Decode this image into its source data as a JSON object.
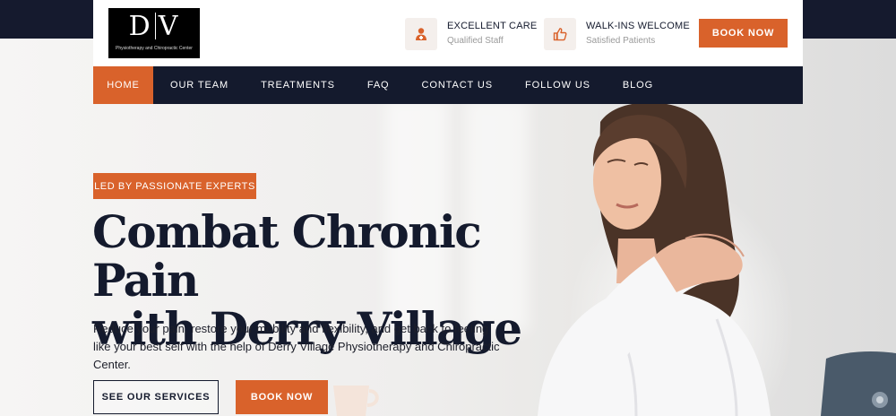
{
  "brand": {
    "logo_mark_left": "D",
    "logo_mark_right": "V",
    "logo_tagline": "Physiotherapy and Chiropractic Center"
  },
  "header": {
    "info": [
      {
        "title": "EXCELLENT CARE",
        "subtitle": "Qualified Staff",
        "icon": "doctor-icon"
      },
      {
        "title": "WALK-INS WELCOME",
        "subtitle": "Satisfied Patients",
        "icon": "thumbs-up-icon"
      }
    ],
    "book_label": "BOOK NOW"
  },
  "nav": {
    "items": [
      "HOME",
      "OUR TEAM",
      "TREATMENTS",
      "FAQ",
      "CONTACT US",
      "FOLLOW US",
      "BLOG"
    ],
    "active": "HOME"
  },
  "hero": {
    "badge": "LED BY PASSIONATE EXPERTS",
    "headline_line1": "Combat Chronic Pain",
    "headline_line2": "with Derry Village",
    "lede": "Reduce your pain, restore your mobility and flexibility, and get back to feeling like your best self with the help of Derry Village Physiotherapy and Chiropractic Center.",
    "cta_secondary": "SEE OUR SERVICES",
    "cta_primary": "BOOK NOW"
  },
  "colors": {
    "accent": "#d9622b",
    "navy": "#141a2d",
    "white": "#ffffff"
  }
}
